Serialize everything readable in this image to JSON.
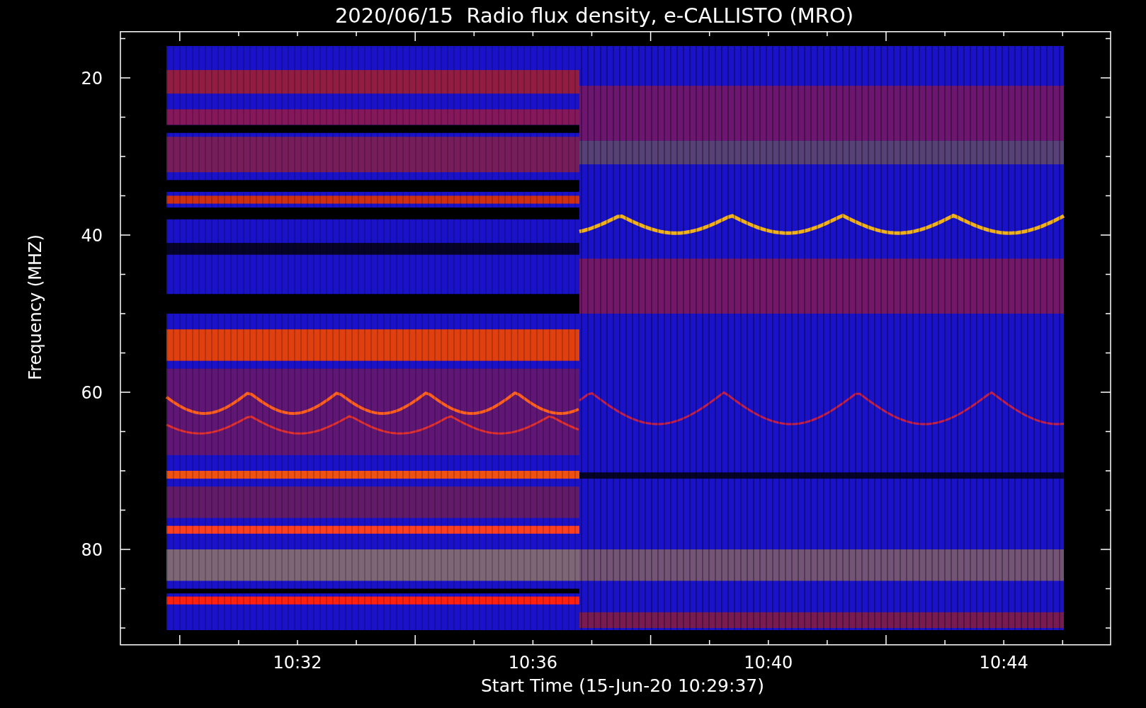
{
  "title": "2020/06/15  Radio flux density, e-CALLISTO (MRO)",
  "y_axis": {
    "label": "Frequency (MHZ)",
    "ticks": [
      "20",
      "40",
      "60",
      "80"
    ]
  },
  "x_axis": {
    "label": "Start Time (15-Jun-20 10:29:37)",
    "ticks": [
      "10:32",
      "10:36",
      "10:40",
      "10:44"
    ]
  }
}
